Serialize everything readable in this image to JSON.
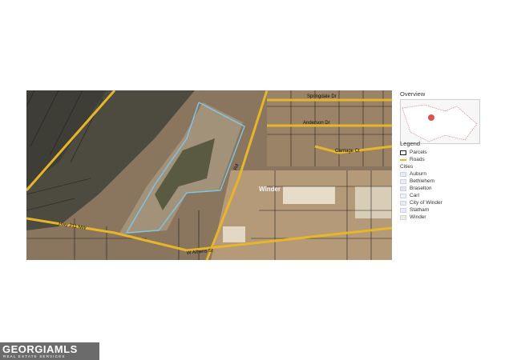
{
  "map": {
    "streets": {
      "springdale": "Springdale Dr",
      "anderson": "Anderson Dr",
      "carriage": "Carriage Ct",
      "hwy": "Hwy 211 NW",
      "athens": "W Athens St",
      "side": "Rd"
    },
    "city_label": "Winder"
  },
  "overview": {
    "title": "Overview",
    "marker_color": "#d9534f"
  },
  "legend": {
    "title": "Legend",
    "parcels": "Parcels",
    "roads": "Roads",
    "cities_title": "Cities",
    "cities": [
      {
        "name": "Auburn",
        "color": "#e3ecf8"
      },
      {
        "name": "Bethlehem",
        "color": "#e6eef6"
      },
      {
        "name": "Braselton",
        "color": "#dfe6f2"
      },
      {
        "name": "Carl",
        "color": "#eef2f8"
      },
      {
        "name": "City of Winder",
        "color": "#e4ebf5"
      },
      {
        "name": "Statham",
        "color": "#e8eef7"
      },
      {
        "name": "Winder",
        "color": "#f3efd2"
      }
    ]
  },
  "brand": {
    "name": "GEORGIAMLS",
    "sub": "REAL ESTATE SERVICES"
  }
}
